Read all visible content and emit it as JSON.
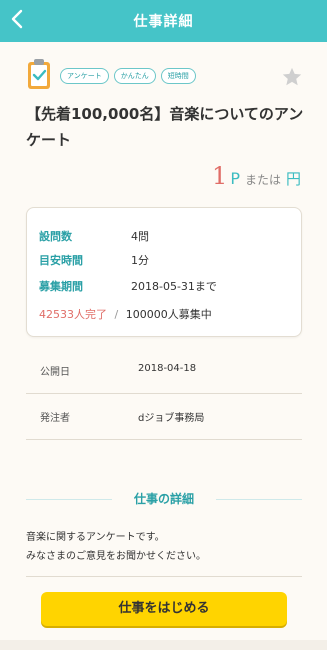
{
  "header": {
    "back_icon": "chevron-left-icon",
    "title": "仕事詳細",
    "background": "#45c4c8"
  },
  "job": {
    "category_icon": "clipboard-check-icon",
    "tags": [
      "アンケート",
      "かんたん",
      "短時間"
    ],
    "favorite_icon": "star-icon",
    "title": "【先着100,000名】音楽についてのアンケート",
    "reward": {
      "number": "1",
      "unit": "P",
      "or_label": "または",
      "yen_label": "円"
    },
    "info": [
      {
        "label": "設問数",
        "value": "4問"
      },
      {
        "label": "目安時間",
        "value": "1分"
      },
      {
        "label": "募集期間",
        "value": "2018-05-31まで"
      }
    ],
    "progress": {
      "completed": "42533人完了",
      "separator": "/",
      "recruiting": "100000人募集中"
    },
    "details": [
      {
        "label": "公開日",
        "value": "2018-04-18"
      },
      {
        "label": "発注者",
        "value": "dジョブ事務局"
      }
    ],
    "section_title": "仕事の詳細",
    "description_lines": [
      "音楽に関するアンケートです。",
      "みなさまのご意見をお聞かせください。"
    ]
  },
  "cta": {
    "label": "仕事をはじめる",
    "color": "#ffd400"
  }
}
